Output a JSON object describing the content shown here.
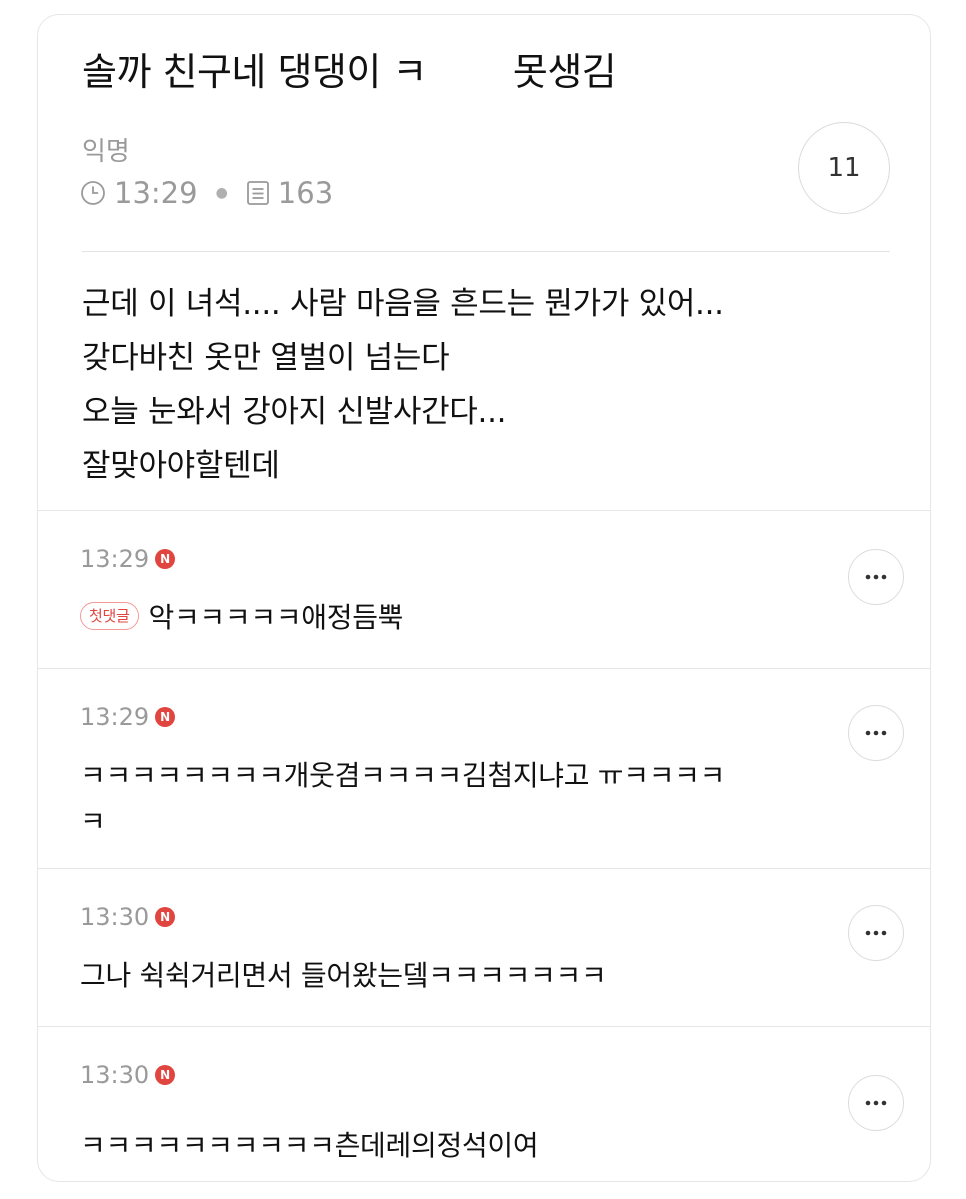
{
  "post": {
    "title_part1": "솔까 친구네 댕댕이 ㅋ",
    "title_part2": "못생김",
    "author": "익명",
    "time": "13:29",
    "views": "163",
    "comment_count": "11",
    "body_lines": [
      "근데 이 녀석.... 사람 마음을 흔드는 뭔가가 있어...",
      "갖다바친 옷만 열벌이 넘는다",
      "오늘 눈와서 강아지 신발사간다...",
      "잘맞아야할텐데"
    ]
  },
  "comments": [
    {
      "time": "13:29",
      "badge": "N",
      "first_label": "첫댓글",
      "lines": [
        "악ㅋㅋㅋㅋㅋ애정듬뿍"
      ]
    },
    {
      "time": "13:29",
      "badge": "N",
      "lines": [
        "ㅋㅋㅋㅋㅋㅋㅋㅋ개웃겸ㅋㅋㅋㅋ김첨지냐고 ㅠㅋㅋㅋㅋ",
        "ㅋ"
      ]
    },
    {
      "time": "13:30",
      "badge": "N",
      "lines": [
        "그나 쉭쉭거리면서 들어왔는뎈ㅋㅋㅋㅋㅋㅋㅋ"
      ]
    },
    {
      "time": "13:30",
      "badge": "N",
      "lines": [
        "ㅋㅋㅋㅋㅋㅋㅋㅋㅋㅋ츤데레의정석이여"
      ]
    }
  ],
  "colors": {
    "accent_red": "#e0453f",
    "meta_gray": "#9a9a9a",
    "divider": "#e6e6e6"
  },
  "icons": {
    "time": "clock-icon",
    "views": "document-icon",
    "badge": "new-badge",
    "more": "more-icon"
  }
}
